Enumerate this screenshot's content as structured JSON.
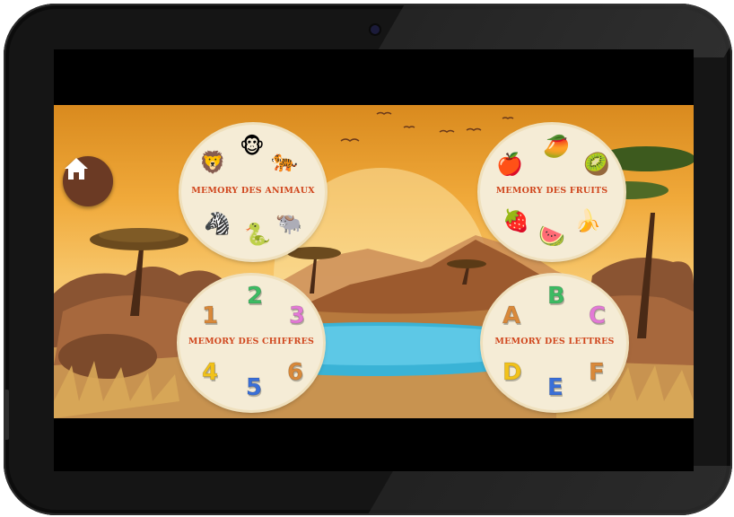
{
  "home": {
    "icon": "home-icon"
  },
  "games": {
    "animals": {
      "title": "MEMORY DES ANIMAUX",
      "icons": [
        {
          "name": "lion-icon",
          "glyph": "🦁"
        },
        {
          "name": "monkey-icon",
          "glyph": "🐵"
        },
        {
          "name": "tiger-icon",
          "glyph": "🐅"
        },
        {
          "name": "zebra-icon",
          "glyph": "🦓"
        },
        {
          "name": "snake-icon",
          "glyph": "🐍"
        },
        {
          "name": "buffalo-icon",
          "glyph": "🐃"
        }
      ]
    },
    "fruits": {
      "title": "MEMORY DES FRUITS",
      "icons": [
        {
          "name": "pomegranate-icon",
          "glyph": "🍎"
        },
        {
          "name": "mango-icon",
          "glyph": "🥭"
        },
        {
          "name": "kiwi-icon",
          "glyph": "🥝"
        },
        {
          "name": "strawberry-icon",
          "glyph": "🍓"
        },
        {
          "name": "watermelon-icon",
          "glyph": "🍉"
        },
        {
          "name": "banana-icon",
          "glyph": "🍌"
        }
      ]
    },
    "numbers": {
      "title": "MEMORY DES CHIFFRES",
      "digits": [
        "1",
        "2",
        "3",
        "4",
        "5",
        "6"
      ],
      "colors": [
        "#d9893a",
        "#3dbb63",
        "#e37ad6",
        "#f2c21a",
        "#3a6fd8",
        "#d9893a"
      ]
    },
    "letters": {
      "title": "MEMORY DES LETTRES",
      "letters": [
        "A",
        "B",
        "C",
        "D",
        "E",
        "F"
      ],
      "colors": [
        "#d9893a",
        "#3dbb63",
        "#e37ad6",
        "#f2c21a",
        "#3a6fd8",
        "#d9893a"
      ]
    }
  }
}
